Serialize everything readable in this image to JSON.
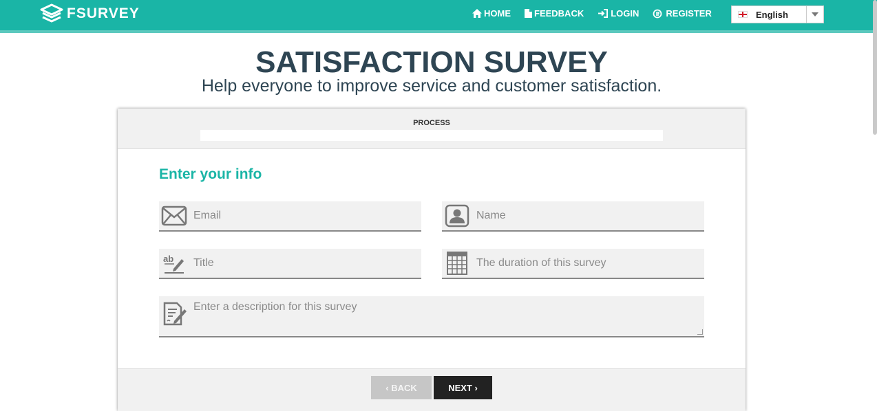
{
  "brand": {
    "name": "FSURVEY",
    "color": "#1ab5a6"
  },
  "nav": {
    "links": [
      {
        "label": "HOME",
        "icon": "home-icon"
      },
      {
        "label": "FEEDBACK",
        "icon": "file-icon"
      },
      {
        "label": "LOGIN",
        "icon": "login-icon"
      },
      {
        "label": "REGISTER",
        "icon": "register-icon"
      }
    ],
    "language": {
      "selected": "English",
      "flag": "england-flag-icon"
    }
  },
  "header": {
    "title": "SATISFACTION SURVEY",
    "subtitle": "Help everyone to improve service and customer satisfaction."
  },
  "card": {
    "process_label": "PROCESS",
    "progress_percent": 0,
    "section_title": "Enter your info",
    "fields": {
      "email": {
        "placeholder": "Email",
        "value": "",
        "icon": "envelope-icon"
      },
      "name": {
        "placeholder": "Name",
        "value": "",
        "icon": "user-icon"
      },
      "title": {
        "placeholder": "Title",
        "value": "",
        "icon": "spell-check-icon"
      },
      "duration": {
        "placeholder": "The duration of this survey",
        "value": "",
        "icon": "calendar-icon"
      },
      "description": {
        "placeholder": "Enter a description for this survey",
        "value": "",
        "icon": "document-edit-icon"
      }
    },
    "buttons": {
      "back": "BACK",
      "next": "NEXT"
    }
  }
}
